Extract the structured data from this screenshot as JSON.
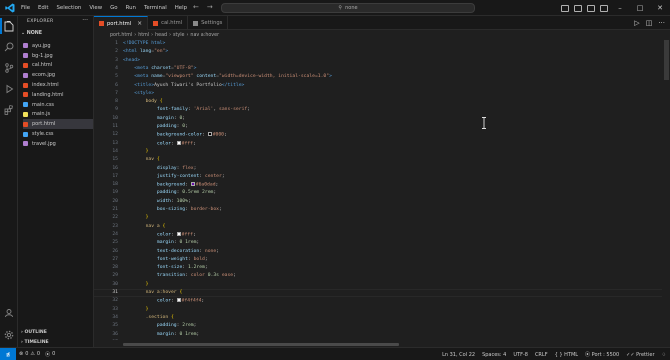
{
  "menu": [
    "File",
    "Edit",
    "Selection",
    "View",
    "Go",
    "Run",
    "Terminal",
    "Help"
  ],
  "search": {
    "label": "none"
  },
  "explorer": {
    "title": "EXPLORER",
    "folder": "NONE",
    "files": [
      {
        "name": "ayu.jpg",
        "icon_color": "#b07fd0"
      },
      {
        "name": "bg-1.jpg",
        "icon_color": "#b07fd0"
      },
      {
        "name": "cal.html",
        "icon_color": "#e44d26"
      },
      {
        "name": "ecom.jpg",
        "icon_color": "#b07fd0"
      },
      {
        "name": "index.html",
        "icon_color": "#e44d26"
      },
      {
        "name": "landing.html",
        "icon_color": "#e44d26"
      },
      {
        "name": "main.css",
        "icon_color": "#42a5f5"
      },
      {
        "name": "main.js",
        "icon_color": "#f1e05a"
      },
      {
        "name": "port.html",
        "icon_color": "#e44d26"
      },
      {
        "name": "style.css",
        "icon_color": "#42a5f5"
      },
      {
        "name": "travel.jpg",
        "icon_color": "#b07fd0"
      }
    ],
    "selected_index": 8,
    "outline": "OUTLINE",
    "timeline": "TIMELINE"
  },
  "tabs": [
    {
      "label": "port.html",
      "active": true
    },
    {
      "label": "cal.html",
      "active": false
    },
    {
      "label": "Settings",
      "active": false
    }
  ],
  "breadcrumb": [
    "port.html",
    "html",
    "head",
    "style",
    "nav a:hover"
  ],
  "editor": {
    "current_line": 31,
    "lines": [
      {
        "n": 1,
        "toks": [
          [
            "doc",
            "<!DOCTYPE html>"
          ]
        ]
      },
      {
        "n": 2,
        "toks": [
          [
            "tag",
            "<html "
          ],
          [
            "attr",
            "lang"
          ],
          [
            "punc",
            "="
          ],
          [
            "str",
            "\"en\""
          ],
          [
            "tag",
            ">"
          ]
        ]
      },
      {
        "n": 3,
        "toks": [
          [
            "tag",
            "<head>"
          ]
        ]
      },
      {
        "n": 4,
        "toks": [
          [
            "txt",
            "    "
          ],
          [
            "tag",
            "<meta "
          ],
          [
            "attr",
            "charset"
          ],
          [
            "punc",
            "="
          ],
          [
            "str",
            "\"UTF-8\""
          ],
          [
            "tag",
            ">"
          ]
        ]
      },
      {
        "n": 5,
        "toks": [
          [
            "txt",
            "    "
          ],
          [
            "tag",
            "<meta "
          ],
          [
            "attr",
            "name"
          ],
          [
            "punc",
            "="
          ],
          [
            "str",
            "\"viewport\""
          ],
          [
            "attr",
            " content"
          ],
          [
            "punc",
            "="
          ],
          [
            "str",
            "\"width=device-width, initial-scale=1.0\""
          ],
          [
            "tag",
            ">"
          ]
        ]
      },
      {
        "n": 6,
        "toks": [
          [
            "txt",
            "    "
          ],
          [
            "tag",
            "<title>"
          ],
          [
            "txt",
            "Ayush Tiwari's Portfolio"
          ],
          [
            "tag",
            "</title>"
          ]
        ]
      },
      {
        "n": 7,
        "toks": [
          [
            "txt",
            "    "
          ],
          [
            "tag",
            "<style>"
          ]
        ]
      },
      {
        "n": 8,
        "toks": [
          [
            "txt",
            "        "
          ],
          [
            "sel",
            "body "
          ],
          [
            "brace",
            "{"
          ]
        ]
      },
      {
        "n": 9,
        "toks": [
          [
            "txt",
            "            "
          ],
          [
            "prop",
            "font-family"
          ],
          [
            "txt",
            ": "
          ],
          [
            "val",
            "'Arial'"
          ],
          [
            "txt",
            ", "
          ],
          [
            "val",
            "sans-serif"
          ],
          [
            "txt",
            ";"
          ]
        ]
      },
      {
        "n": 10,
        "toks": [
          [
            "txt",
            "            "
          ],
          [
            "prop",
            "margin"
          ],
          [
            "txt",
            ": "
          ],
          [
            "num",
            "0"
          ],
          [
            "txt",
            ";"
          ]
        ]
      },
      {
        "n": 11,
        "toks": [
          [
            "txt",
            "            "
          ],
          [
            "prop",
            "padding"
          ],
          [
            "txt",
            ": "
          ],
          [
            "num",
            "0"
          ],
          [
            "txt",
            ";"
          ]
        ]
      },
      {
        "n": 12,
        "toks": [
          [
            "txt",
            "            "
          ],
          [
            "prop",
            "background-color"
          ],
          [
            "txt",
            ": "
          ],
          [
            "sw",
            "#000000"
          ],
          [
            "val",
            "#000"
          ],
          [
            "txt",
            ";"
          ]
        ]
      },
      {
        "n": 13,
        "toks": [
          [
            "txt",
            "            "
          ],
          [
            "prop",
            "color"
          ],
          [
            "txt",
            ": "
          ],
          [
            "sw",
            "#ffffff"
          ],
          [
            "val",
            "#fff"
          ],
          [
            "txt",
            ";"
          ]
        ]
      },
      {
        "n": 14,
        "toks": [
          [
            "txt",
            "        "
          ],
          [
            "brace",
            "}"
          ]
        ]
      },
      {
        "n": 15,
        "toks": [
          [
            "txt",
            "        "
          ],
          [
            "sel",
            "nav "
          ],
          [
            "brace",
            "{"
          ]
        ]
      },
      {
        "n": 16,
        "toks": [
          [
            "txt",
            "            "
          ],
          [
            "prop",
            "display"
          ],
          [
            "txt",
            ": "
          ],
          [
            "val",
            "flex"
          ],
          [
            "txt",
            ";"
          ]
        ]
      },
      {
        "n": 17,
        "toks": [
          [
            "txt",
            "            "
          ],
          [
            "prop",
            "justify-content"
          ],
          [
            "txt",
            ": "
          ],
          [
            "val",
            "center"
          ],
          [
            "txt",
            ";"
          ]
        ]
      },
      {
        "n": 18,
        "toks": [
          [
            "txt",
            "            "
          ],
          [
            "prop",
            "background"
          ],
          [
            "txt",
            ": "
          ],
          [
            "sw",
            "#6a0dad"
          ],
          [
            "val",
            "#6a0dad"
          ],
          [
            "txt",
            ";"
          ]
        ]
      },
      {
        "n": 19,
        "toks": [
          [
            "txt",
            "            "
          ],
          [
            "prop",
            "padding"
          ],
          [
            "txt",
            ": "
          ],
          [
            "num",
            "0.5rem 2rem"
          ],
          [
            "txt",
            ";"
          ]
        ]
      },
      {
        "n": 20,
        "toks": [
          [
            "txt",
            "            "
          ],
          [
            "prop",
            "width"
          ],
          [
            "txt",
            ": "
          ],
          [
            "num",
            "100%"
          ],
          [
            "txt",
            ";"
          ]
        ]
      },
      {
        "n": 21,
        "toks": [
          [
            "txt",
            "            "
          ],
          [
            "prop",
            "box-sizing"
          ],
          [
            "txt",
            ": "
          ],
          [
            "val",
            "border-box"
          ],
          [
            "txt",
            ";"
          ]
        ]
      },
      {
        "n": 22,
        "toks": [
          [
            "txt",
            "        "
          ],
          [
            "brace",
            "}"
          ]
        ]
      },
      {
        "n": 23,
        "toks": [
          [
            "txt",
            "        "
          ],
          [
            "sel",
            "nav a "
          ],
          [
            "brace",
            "{"
          ]
        ]
      },
      {
        "n": 24,
        "toks": [
          [
            "txt",
            "            "
          ],
          [
            "prop",
            "color"
          ],
          [
            "txt",
            ": "
          ],
          [
            "sw",
            "#ffffff"
          ],
          [
            "val",
            "#fff"
          ],
          [
            "txt",
            ";"
          ]
        ]
      },
      {
        "n": 25,
        "toks": [
          [
            "txt",
            "            "
          ],
          [
            "prop",
            "margin"
          ],
          [
            "txt",
            ": "
          ],
          [
            "num",
            "0 1rem"
          ],
          [
            "txt",
            ";"
          ]
        ]
      },
      {
        "n": 26,
        "toks": [
          [
            "txt",
            "            "
          ],
          [
            "prop",
            "text-decoration"
          ],
          [
            "txt",
            ": "
          ],
          [
            "val",
            "none"
          ],
          [
            "txt",
            ";"
          ]
        ]
      },
      {
        "n": 27,
        "toks": [
          [
            "txt",
            "            "
          ],
          [
            "prop",
            "font-weight"
          ],
          [
            "txt",
            ": "
          ],
          [
            "val",
            "bold"
          ],
          [
            "txt",
            ";"
          ]
        ]
      },
      {
        "n": 28,
        "toks": [
          [
            "txt",
            "            "
          ],
          [
            "prop",
            "font-size"
          ],
          [
            "txt",
            ": "
          ],
          [
            "num",
            "1.2rem"
          ],
          [
            "txt",
            ";"
          ]
        ]
      },
      {
        "n": 29,
        "toks": [
          [
            "txt",
            "            "
          ],
          [
            "prop",
            "transition"
          ],
          [
            "txt",
            ": "
          ],
          [
            "val",
            "color "
          ],
          [
            "num",
            "0.3s"
          ],
          [
            "val",
            " ease"
          ],
          [
            "txt",
            ";"
          ]
        ]
      },
      {
        "n": 30,
        "toks": [
          [
            "txt",
            "        "
          ],
          [
            "brace",
            "}"
          ]
        ]
      },
      {
        "n": 31,
        "toks": [
          [
            "txt",
            "        "
          ],
          [
            "sel",
            "nav a:hover "
          ],
          [
            "brace",
            "{"
          ]
        ]
      },
      {
        "n": 32,
        "toks": [
          [
            "txt",
            "            "
          ],
          [
            "prop",
            "color"
          ],
          [
            "txt",
            ": "
          ],
          [
            "sw",
            "#f4f4f4"
          ],
          [
            "val",
            "#f4f4f4"
          ],
          [
            "txt",
            ";"
          ]
        ]
      },
      {
        "n": 33,
        "toks": [
          [
            "txt",
            "        "
          ],
          [
            "brace",
            "}"
          ]
        ]
      },
      {
        "n": 34,
        "toks": [
          [
            "txt",
            "        "
          ],
          [
            "sel",
            ".section "
          ],
          [
            "brace",
            "{"
          ]
        ]
      },
      {
        "n": 35,
        "toks": [
          [
            "txt",
            "            "
          ],
          [
            "prop",
            "padding"
          ],
          [
            "txt",
            ": "
          ],
          [
            "num",
            "2rem"
          ],
          [
            "txt",
            ";"
          ]
        ]
      },
      {
        "n": 36,
        "toks": [
          [
            "txt",
            "            "
          ],
          [
            "prop",
            "margin"
          ],
          [
            "txt",
            ": "
          ],
          [
            "num",
            "0 1rem"
          ],
          [
            "txt",
            ";"
          ]
        ]
      },
      {
        "n": 37,
        "toks": [
          [
            "txt",
            "            "
          ],
          [
            "prop",
            "background-color"
          ],
          [
            "txt",
            ": "
          ],
          [
            "sw",
            "#111111"
          ],
          [
            "val",
            "#111"
          ],
          [
            "txt",
            ";"
          ]
        ]
      }
    ]
  },
  "statusbar": {
    "errors": "0",
    "warnings": "0",
    "ports": "0",
    "position": "Ln 31, Col 22",
    "spaces": "Spaces: 4",
    "encoding": "UTF-8",
    "eol": "CRLF",
    "language": "HTML",
    "port": "Port : 5500",
    "formatter": "Prettier"
  },
  "colors": {
    "accent": "#0078d4",
    "bg": "#1f1f1f",
    "panel": "#181818"
  }
}
